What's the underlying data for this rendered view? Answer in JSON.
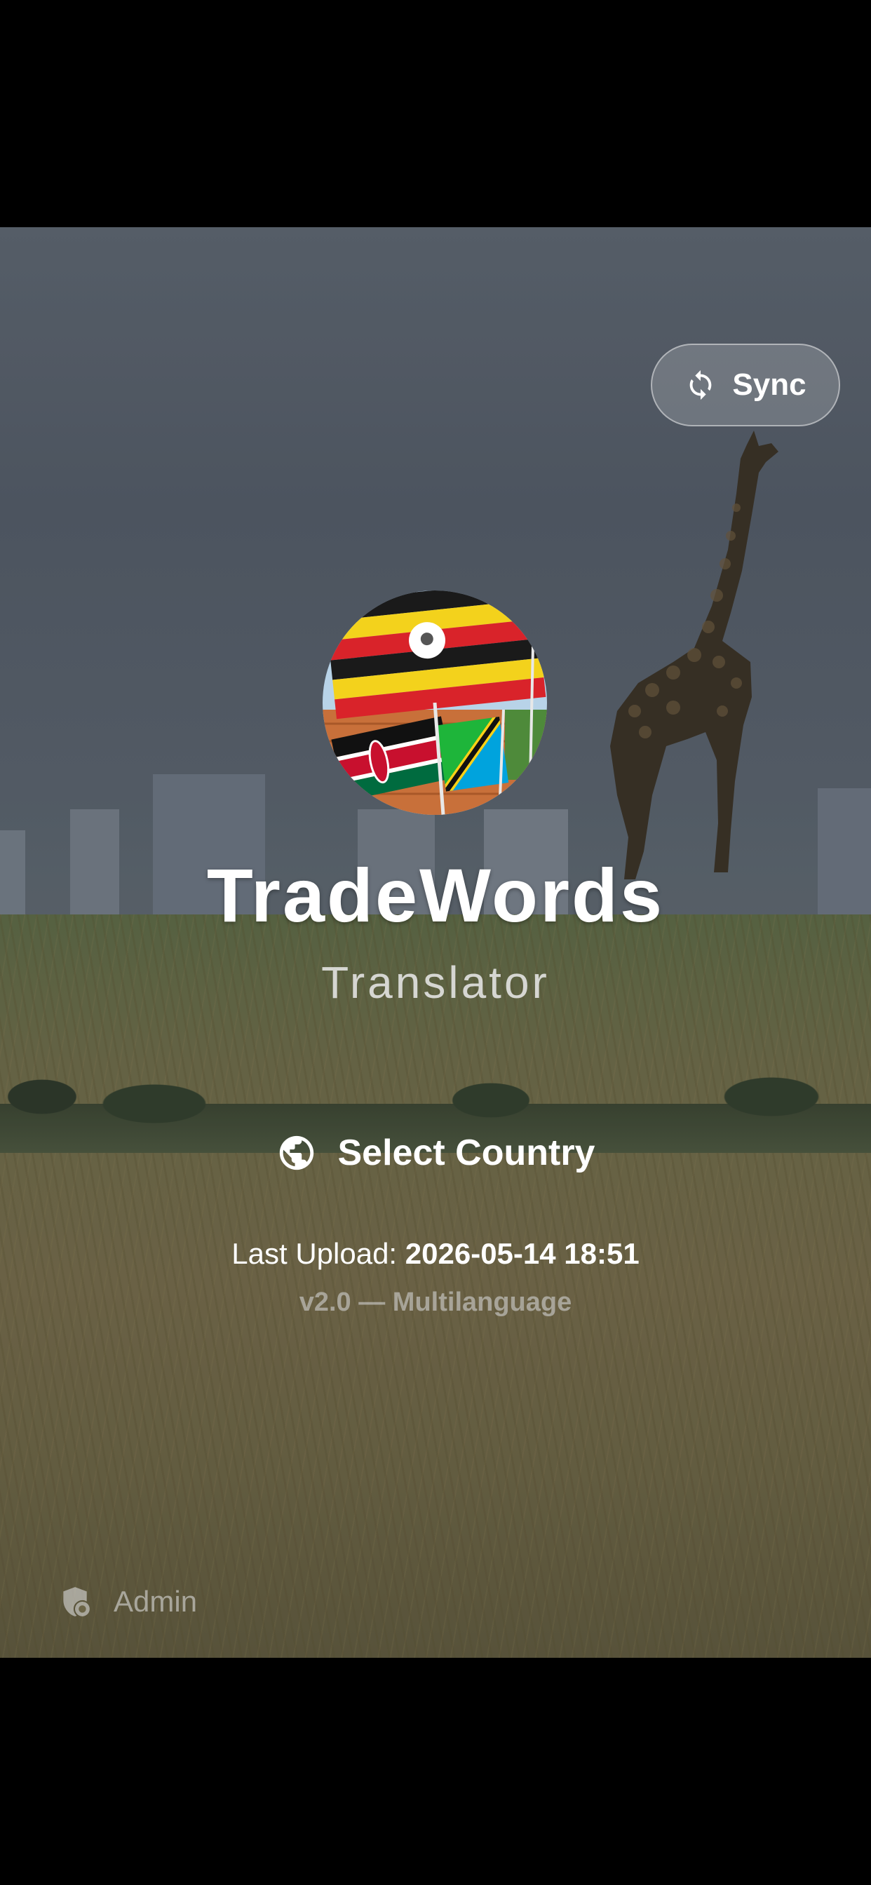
{
  "header": {
    "sync_label": "Sync"
  },
  "app": {
    "title": "TradeWords",
    "subtitle": "Translator"
  },
  "actions": {
    "select_country_label": "Select Country"
  },
  "status": {
    "last_upload_label": "Last Upload:",
    "last_upload_value": "2026-05-14 18:51",
    "version": "v2.0 — Multilanguage"
  },
  "footer": {
    "admin_label": "Admin"
  },
  "icons": {
    "sync": "sync-icon",
    "globe": "globe-icon",
    "admin": "admin-shield-icon"
  }
}
